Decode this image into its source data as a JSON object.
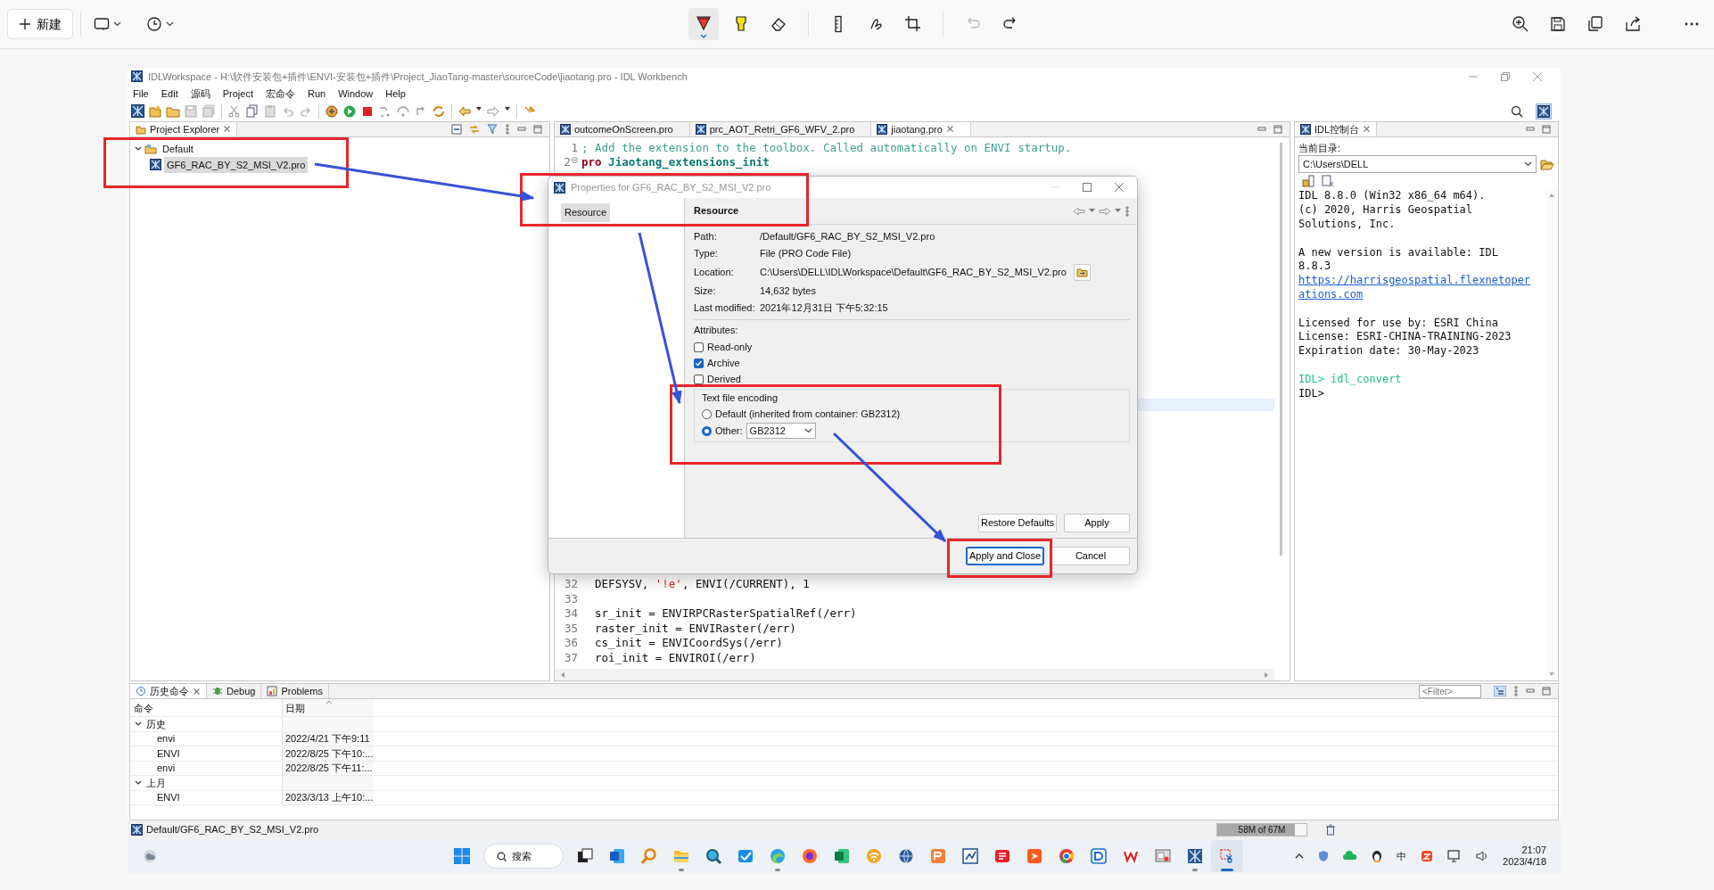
{
  "snip_toolbar": {
    "new_button": "新建",
    "tools": [
      {
        "kind": "pen",
        "selected": true,
        "disabled": false
      },
      {
        "kind": "highlighter",
        "selected": false,
        "disabled": false
      },
      {
        "kind": "eraser",
        "selected": false,
        "disabled": false
      },
      {
        "kind": "ruler",
        "selected": false,
        "disabled": false
      },
      {
        "kind": "touch",
        "selected": false,
        "disabled": false
      },
      {
        "kind": "crop",
        "selected": false,
        "disabled": false
      },
      {
        "kind": "undo",
        "selected": false,
        "disabled": true
      },
      {
        "kind": "redo",
        "selected": false,
        "disabled": false
      }
    ]
  },
  "window": {
    "title": "IDLWorkspace - H:\\软件安装包+插件\\ENVI-安装包+插件\\Project_JiaoTang-master\\sourceCode\\jiaotang.pro - IDL Workbench"
  },
  "menu": [
    "File",
    "Edit",
    "源码",
    "Project",
    "宏命令",
    "Run",
    "Window",
    "Help"
  ],
  "project_explorer": {
    "tab": "Project Explorer",
    "tree": [
      {
        "label": "Default",
        "expanded": true,
        "children": [
          {
            "label": "GF6_RAC_BY_S2_MSI_V2.pro",
            "selected": true
          }
        ]
      }
    ]
  },
  "editor": {
    "tabs": [
      {
        "label": "outcomeOnScreen.pro",
        "selected": false
      },
      {
        "label": "prc_AOT_Retri_GF6_WFV_2.pro",
        "selected": false
      },
      {
        "label": "jiaotang.pro",
        "selected": true
      }
    ],
    "lines_top": [
      {
        "number": "1",
        "segments": [
          {
            "kind": "comment",
            "text": "; Add the extension to the toolbox. Called automatically on ENVI startup."
          }
        ]
      },
      {
        "number": "2",
        "folded": false,
        "segments": [
          {
            "kind": "keyword",
            "text": "pro"
          },
          {
            "kind": "name",
            "text": "Jiaotang_extensions_init"
          }
        ]
      }
    ],
    "lines_bottom": [
      {
        "number": "32",
        "segments": [
          {
            "kind": "plain",
            "text": "  DEFSYSV, "
          },
          {
            "kind": "string",
            "text": "'!e'"
          },
          {
            "kind": "plain",
            "text": ", ENVI(/CURRENT), 1"
          }
        ]
      },
      {
        "number": "33"
      },
      {
        "number": "34",
        "segments": [
          {
            "kind": "plain",
            "text": "  sr_init = ENVIRPCRasterSpatialRef(/err)"
          }
        ]
      },
      {
        "number": "35",
        "segments": [
          {
            "kind": "plain",
            "text": "  raster_init = ENVIRaster(/err)"
          }
        ]
      },
      {
        "number": "36",
        "segments": [
          {
            "kind": "plain",
            "text": "  cs_init = ENVICoordSys(/err)"
          }
        ]
      },
      {
        "number": "37",
        "segments": [
          {
            "kind": "plain",
            "text": "  roi_init = ENVIROI(/err)"
          }
        ]
      }
    ]
  },
  "console": {
    "tab": "IDL控制台",
    "dir_label": "当前目录:",
    "dir_value": "C:\\Users\\DELL",
    "lines": [
      {
        "kind": "output",
        "text": "IDL 8.8.0 (Win32 x86_64 m64)."
      },
      {
        "kind": "output",
        "text": "(c) 2020, Harris Geospatial"
      },
      {
        "kind": "output",
        "text": "Solutions, Inc."
      },
      {
        "kind": "blank"
      },
      {
        "kind": "output",
        "text": "A new version is available: IDL"
      },
      {
        "kind": "output",
        "text": "8.8.3"
      },
      {
        "kind": "link",
        "text": "https://harrisgeospatial.flexnetoper"
      },
      {
        "kind": "link",
        "text": "ations.com"
      },
      {
        "kind": "blank"
      },
      {
        "kind": "output",
        "text": "Licensed for use by: ESRI China"
      },
      {
        "kind": "output",
        "text": "License: ESRI-CHINA-TRAINING-2023"
      },
      {
        "kind": "output",
        "text": "Expiration date: 30-May-2023"
      },
      {
        "kind": "blank"
      },
      {
        "kind": "command",
        "text": "IDL> idl_convert"
      },
      {
        "kind": "output",
        "text": "IDL>"
      }
    ]
  },
  "dialog": {
    "title": "Properties for GF6_RAC_BY_S2_MSI_V2.pro",
    "nav": [
      {
        "label": "Resource",
        "selected": true
      }
    ],
    "heading": "Resource",
    "fields": [
      {
        "label": "Path:",
        "value": "/Default/GF6_RAC_BY_S2_MSI_V2.pro"
      },
      {
        "label": "Type:",
        "value": "File  (PRO Code File)"
      },
      {
        "label": "Location:",
        "value": "C:\\Users\\DELL\\IDLWorkspace\\Default\\GF6_RAC_BY_S2_MSI_V2.pro",
        "kind": "location"
      },
      {
        "label": "Size:",
        "value": "14,632  bytes"
      },
      {
        "label": "Last modified:",
        "value": "2021年12月31日 下午5:32:15"
      }
    ],
    "attributes_label": "Attributes:",
    "attributes": [
      {
        "label": "Read-only",
        "checked": false
      },
      {
        "label": "Archive",
        "checked": true
      },
      {
        "label": "Derived",
        "checked": false
      }
    ],
    "encoding": {
      "legend": "Text file encoding",
      "options": [
        {
          "label": "Default (inherited from container: GB2312)",
          "selected": false
        },
        {
          "label": "Other:",
          "selected": true
        }
      ],
      "value": "GB2312"
    },
    "page_buttons": [
      "Restore Defaults",
      "Apply"
    ],
    "footer_buttons": [
      {
        "label": "Apply and Close",
        "default": true
      },
      {
        "label": "Cancel",
        "default": false
      }
    ]
  },
  "history": {
    "tabs": [
      {
        "label": "历史命令",
        "selected": true
      },
      {
        "label": "Debug",
        "selected": false
      },
      {
        "label": "Problems",
        "selected": false
      }
    ],
    "filter": {
      "placeholder": "<Filter>"
    },
    "columns": [
      "命令",
      "日期"
    ],
    "groups": [
      {
        "label": "历史",
        "expanded": true,
        "rows": [
          {
            "command": "envi",
            "date": "2022/4/21 下午9:11"
          },
          {
            "command": "ENVI",
            "date": "2022/8/25 下午10:..."
          },
          {
            "command": "envi",
            "date": "2022/8/25 下午11:..."
          }
        ]
      },
      {
        "label": "上月",
        "expanded": true,
        "rows": [
          {
            "command": "ENVI",
            "date": "2023/3/13 上午10:..."
          }
        ]
      }
    ]
  },
  "status_bar": {
    "path": "Default/GF6_RAC_BY_S2_MSI_V2.pro",
    "memory": {
      "text": "58M of 67M",
      "level": 0.87
    }
  },
  "taskbar": {
    "search": "搜索",
    "apps": [
      {
        "kind": "taskview",
        "running": false,
        "selected": false
      },
      {
        "kind": "word",
        "running": false,
        "selected": false
      },
      {
        "kind": "magnifier",
        "running": false,
        "selected": false
      },
      {
        "kind": "files",
        "running": true,
        "selected": false
      },
      {
        "kind": "search-app",
        "running": false,
        "selected": false
      },
      {
        "kind": "todo",
        "running": false,
        "selected": false
      },
      {
        "kind": "edge",
        "running": true,
        "selected": false
      },
      {
        "kind": "firefox",
        "running": false,
        "selected": false
      },
      {
        "kind": "excel",
        "running": false,
        "selected": false
      },
      {
        "kind": "wifi",
        "running": false,
        "selected": false
      },
      {
        "kind": "globe",
        "running": false,
        "selected": false
      },
      {
        "kind": "pdf",
        "running": false,
        "selected": false
      },
      {
        "kind": "app",
        "running": false,
        "selected": false
      },
      {
        "kind": "dictionary",
        "running": false,
        "selected": false
      },
      {
        "kind": "arrow",
        "running": false,
        "selected": false
      },
      {
        "kind": "chrome",
        "running": false,
        "selected": false
      },
      {
        "kind": "dbox",
        "running": false,
        "selected": false
      },
      {
        "kind": "wps",
        "running": false,
        "selected": false
      },
      {
        "kind": "tool",
        "running": false,
        "selected": false
      },
      {
        "kind": "idl",
        "running": true,
        "selected": false
      },
      {
        "kind": "snip",
        "running": true,
        "selected": true
      }
    ],
    "ime": "中",
    "time": "21:07",
    "date": "2023/4/18"
  }
}
